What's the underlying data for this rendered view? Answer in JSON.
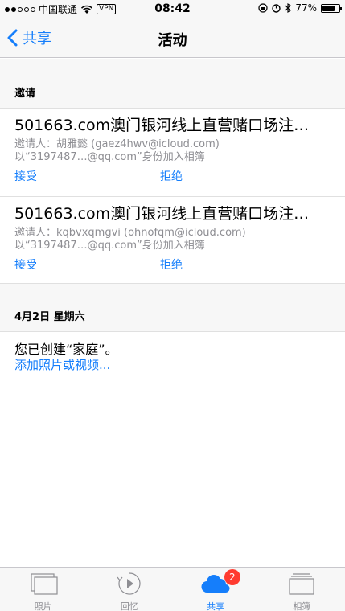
{
  "status_bar": {
    "carrier": "中国联通",
    "vpn": "VPN",
    "time": "08:42",
    "battery": "77%",
    "battery_level": 0.77
  },
  "nav": {
    "back_label": "共享",
    "title": "活动"
  },
  "invitations": {
    "header": "邀请",
    "items": [
      {
        "title": "501663.com澳门银河线上直营赌口场注…",
        "inviter": "邀请人：胡雅懿 (gaez4hwv@icloud.com)",
        "joined_as": "以“3197487…@qq.com”身份加入相簿",
        "accept": "接受",
        "decline": "拒绝"
      },
      {
        "title": "501663.com澳门银河线上直营赌口场注…",
        "inviter": "邀请人：kqbvxqmgvi (ohnofqm@icloud.com)",
        "joined_as": "以“3197487…@qq.com”身份加入相簿",
        "accept": "接受",
        "decline": "拒绝"
      }
    ]
  },
  "activity": {
    "date": "4月2日 星期六",
    "text": "您已创建“家庭”。",
    "link": "添加照片或视频..."
  },
  "tabs": [
    {
      "label": "照片",
      "icon": "photos-icon"
    },
    {
      "label": "回忆",
      "icon": "memories-icon"
    },
    {
      "label": "共享",
      "icon": "cloud-icon",
      "badge": "2"
    },
    {
      "label": "相簿",
      "icon": "albums-icon"
    }
  ],
  "colors": {
    "accent": "#157efb",
    "badge": "#ff3b30"
  }
}
